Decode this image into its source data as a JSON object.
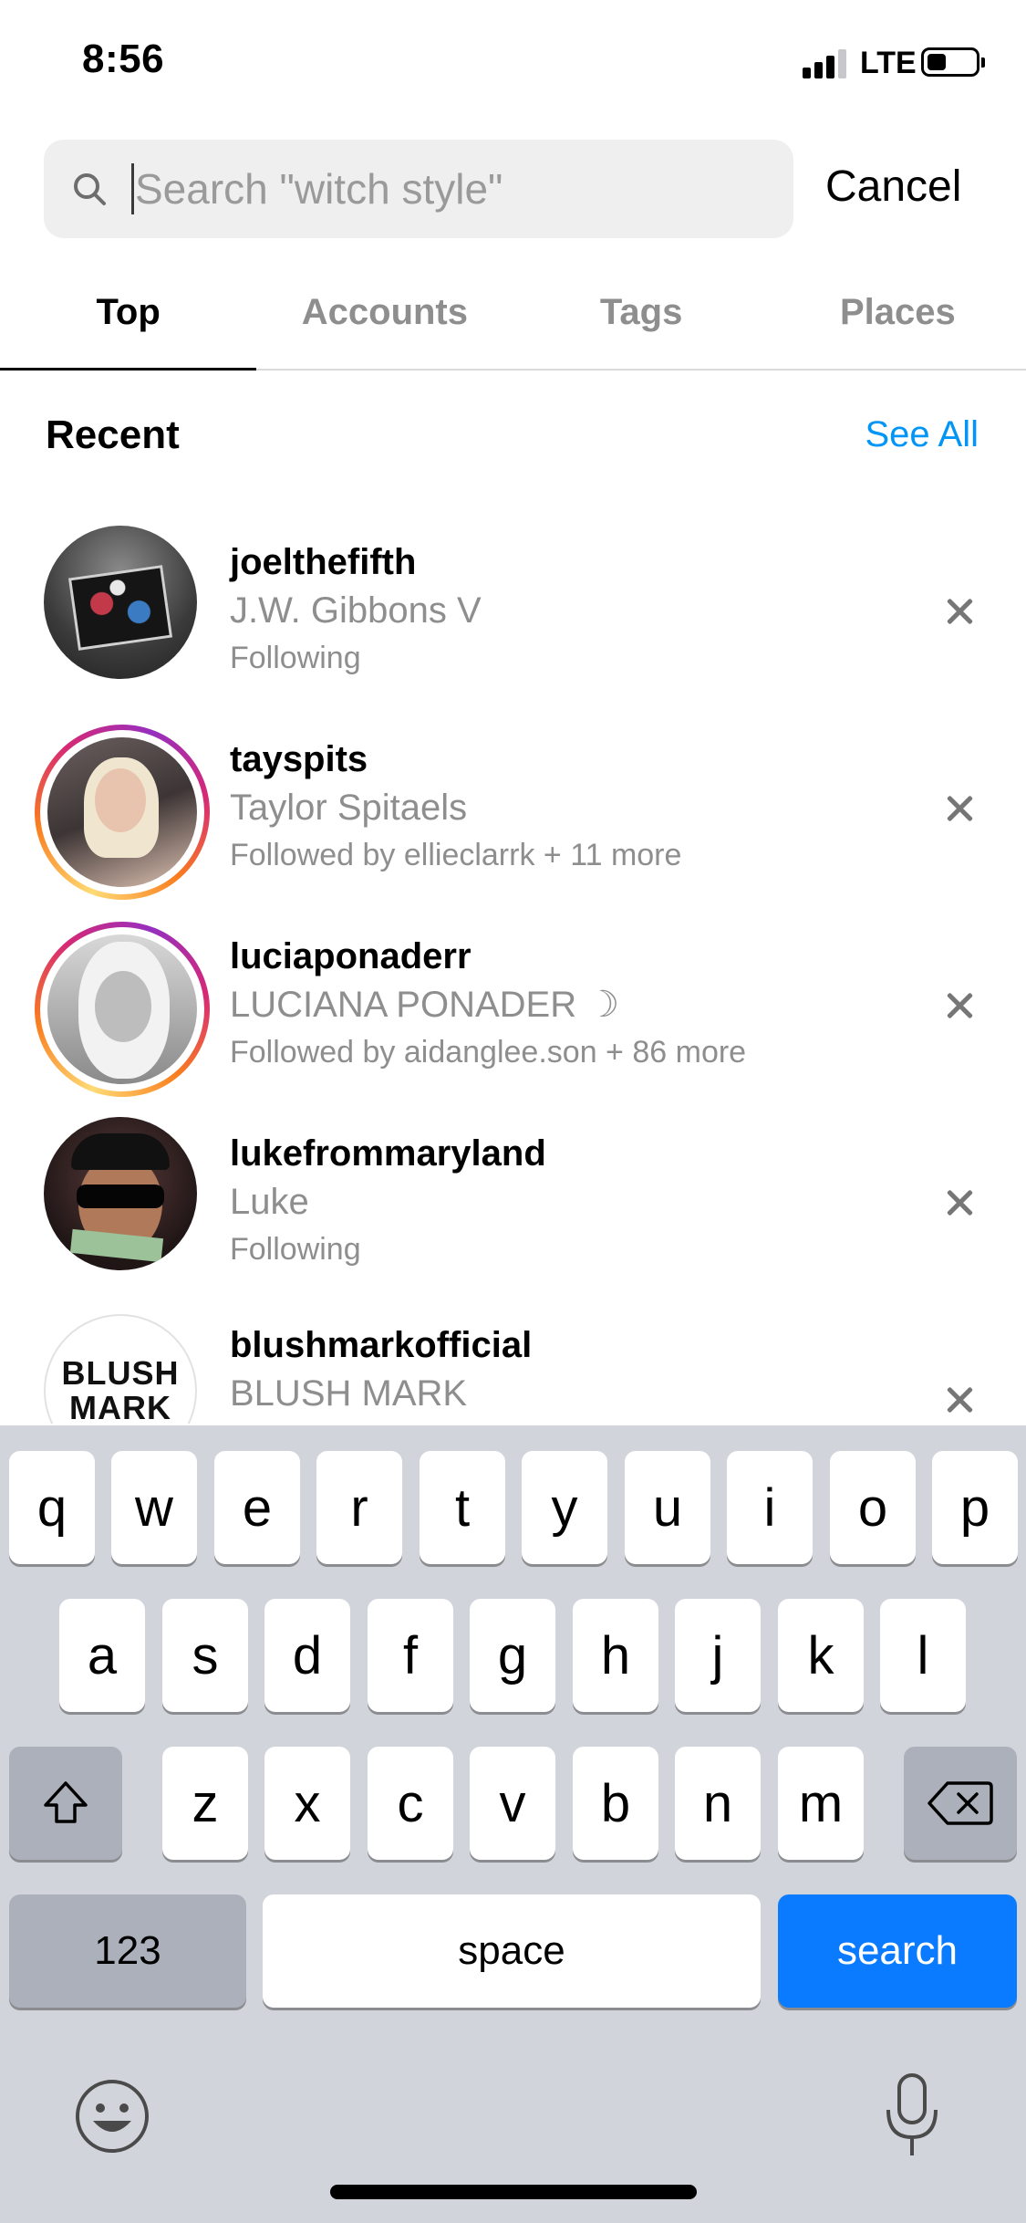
{
  "status_bar": {
    "time": "8:56",
    "network": "LTE"
  },
  "search": {
    "placeholder": "Search \"witch style\"",
    "value": "",
    "cancel_label": "Cancel"
  },
  "tabs": [
    {
      "label": "Top",
      "active": true
    },
    {
      "label": "Accounts",
      "active": false
    },
    {
      "label": "Tags",
      "active": false
    },
    {
      "label": "Places",
      "active": false
    }
  ],
  "recent": {
    "title": "Recent",
    "see_all_label": "See All",
    "items": [
      {
        "username": "joelthefifth",
        "full_name": "J.W. Gibbons V",
        "subtitle": "Following",
        "has_story_ring": false
      },
      {
        "username": "tayspits",
        "full_name": "Taylor Spitaels",
        "subtitle": "Followed by ellieclarrk + 11 more",
        "has_story_ring": true
      },
      {
        "username": "luciaponaderr",
        "full_name": "LUCIANA PONADER ☽",
        "subtitle": "Followed by aidanglee.son + 86 more",
        "has_story_ring": true
      },
      {
        "username": "lukefrommaryland",
        "full_name": "Luke",
        "subtitle": "Following",
        "has_story_ring": false
      },
      {
        "username": "blushmarkofficial",
        "full_name": "BLUSH MARK",
        "subtitle": "",
        "has_story_ring": false,
        "avatar_text": [
          "BLUSH",
          "MARK"
        ]
      }
    ]
  },
  "keyboard": {
    "row1": [
      "q",
      "w",
      "e",
      "r",
      "t",
      "y",
      "u",
      "i",
      "o",
      "p"
    ],
    "row2": [
      "a",
      "s",
      "d",
      "f",
      "g",
      "h",
      "j",
      "k",
      "l"
    ],
    "row3": [
      "z",
      "x",
      "c",
      "v",
      "b",
      "n",
      "m"
    ],
    "numbers_label": "123",
    "space_label": "space",
    "action_label": "search",
    "action_color": "#0a7bff"
  },
  "colors": {
    "link": "#0095f6",
    "secondary_text": "#8e8e8e",
    "keyboard_bg": "#d1d4da"
  }
}
